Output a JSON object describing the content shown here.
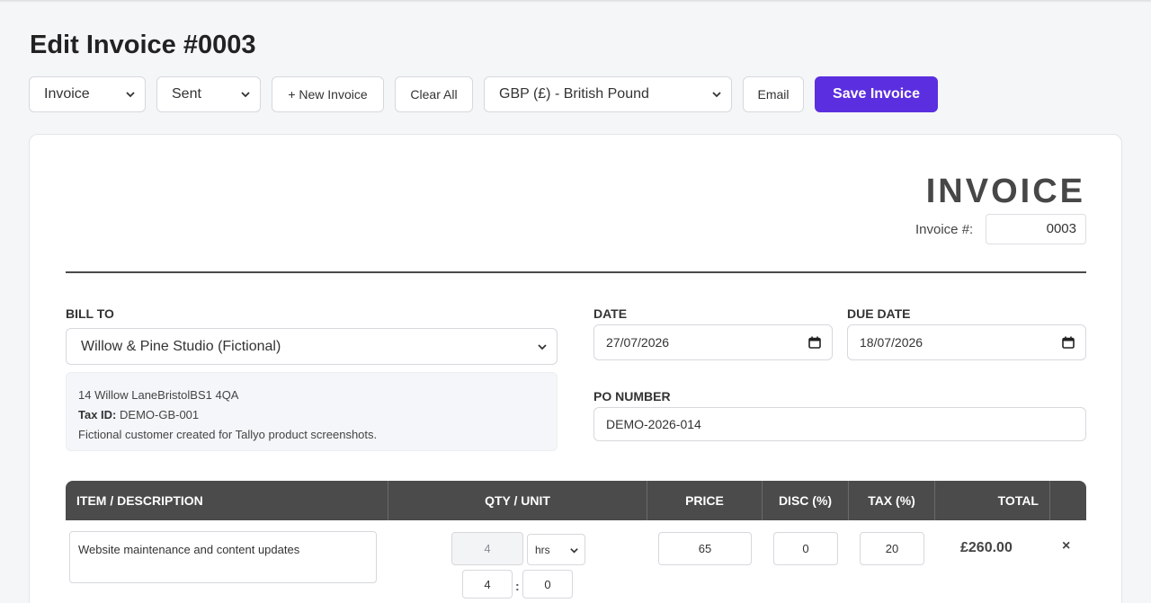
{
  "page": {
    "title": "Edit Invoice #0003"
  },
  "toolbar": {
    "doc_type": "Invoice",
    "status": "Sent",
    "new_invoice": "+ New Invoice",
    "clear_all": "Clear All",
    "currency": "GBP (£) - British Pound",
    "email": "Email",
    "save": "Save Invoice"
  },
  "invoice": {
    "heading": "INVOICE",
    "number_label": "Invoice #:",
    "number_value": "0003",
    "bill_to_label": "BILL TO",
    "client_select": "Willow & Pine Studio (Fictional)",
    "client_address": "14 Willow LaneBristolBS1 4QA",
    "tax_id_label": "Tax ID:",
    "tax_id_value": "DEMO-GB-001",
    "client_note": "Fictional customer created for Tallyo product screenshots.",
    "date_label": "DATE",
    "date_value": "27/07/2026",
    "due_date_label": "DUE DATE",
    "due_date_value": "18/07/2026",
    "po_label": "PO NUMBER",
    "po_value": "DEMO-2026-014"
  },
  "table": {
    "headers": {
      "item": "ITEM / DESCRIPTION",
      "qty": "QTY / UNIT",
      "price": "PRICE",
      "disc": "DISC (%)",
      "tax": "TAX (%)",
      "total": "TOTAL"
    },
    "rows": [
      {
        "description": "Website maintenance and content updates",
        "qty": "4",
        "unit": "hrs",
        "hours": "4",
        "minutes": "0",
        "price": "65",
        "disc": "0",
        "tax": "20",
        "total": "£260.00",
        "remove": "×"
      }
    ]
  },
  "icons": {
    "dropdown": "chevron-down-icon",
    "calendar": "calendar-icon",
    "remove": "close-icon"
  },
  "colors": {
    "primary": "#5b2ee0",
    "table_header": "#4b4b4b"
  }
}
